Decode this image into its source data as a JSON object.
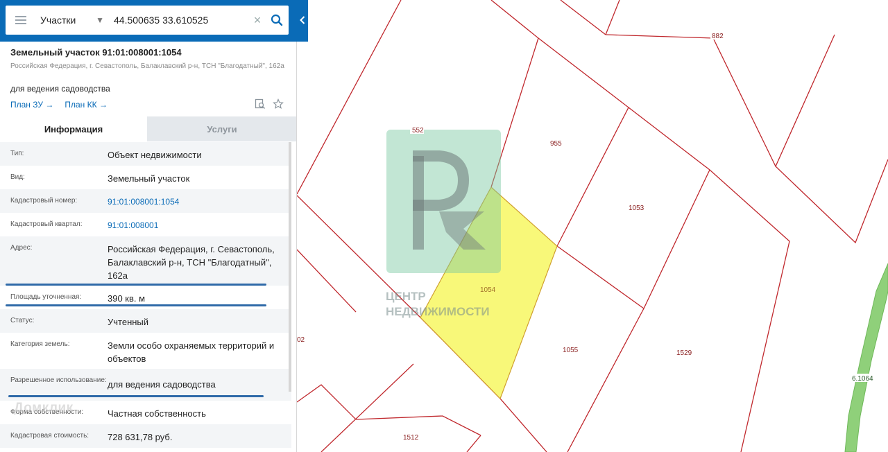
{
  "search": {
    "layer": "Участки",
    "query": "44.500635 33.610525"
  },
  "object": {
    "title": "Земельный участок 91:01:008001:1054",
    "address": "Российская Федерация, г. Севастополь, Балаклавский р-н, ТСН \"Благодатный\", 162а",
    "purpose": "для ведения садоводства",
    "plan_zu": "План ЗУ",
    "plan_kk": "План КК"
  },
  "tabs": {
    "info": "Информация",
    "services": "Услуги"
  },
  "info_rows": [
    {
      "key": "Тип:",
      "value": "Объект недвижимости"
    },
    {
      "key": "Вид:",
      "value": "Земельный участок"
    },
    {
      "key": "Кадастровый номер:",
      "value": "91:01:008001:1054"
    },
    {
      "key": "Кадастровый квартал:",
      "value": "91:01:008001"
    },
    {
      "key": "Адрес:",
      "value": "Российская Федерация, г. Севастополь, Балаклавский р-н, ТСН \"Благодатный\", 162а"
    },
    {
      "key": "Площадь уточненная:",
      "value": "390 кв. м"
    },
    {
      "key": "Статус:",
      "value": "Учтенный"
    },
    {
      "key": "Категория земель:",
      "value": "Земли особо охраняемых территорий и объектов"
    },
    {
      "key": "Разрешенное использование:",
      "value": "для ведения садоводства"
    },
    {
      "key": "Форма собственности:",
      "value": "Частная собственность"
    },
    {
      "key": "Кадастровая стоимость:",
      "value": "728 631,78 руб."
    }
  ],
  "map": {
    "labels": [
      "882",
      "552",
      "955",
      "1053",
      "1054",
      "1055",
      "1529",
      "1512",
      "02",
      "6.1064"
    ],
    "highlight_color": "#f7f76a",
    "boundary_color": "#c0282d",
    "road_color": "#8fd07a"
  },
  "watermark": {
    "logo_letters": "РК",
    "line1": "ЦЕНТР",
    "line2": "НЕДВИЖИМОСТИ",
    "left_text": "Домклик"
  },
  "colors": {
    "header": "#0a6bb7",
    "link": "#0a6bb7",
    "underline": "#2f6aa8"
  }
}
